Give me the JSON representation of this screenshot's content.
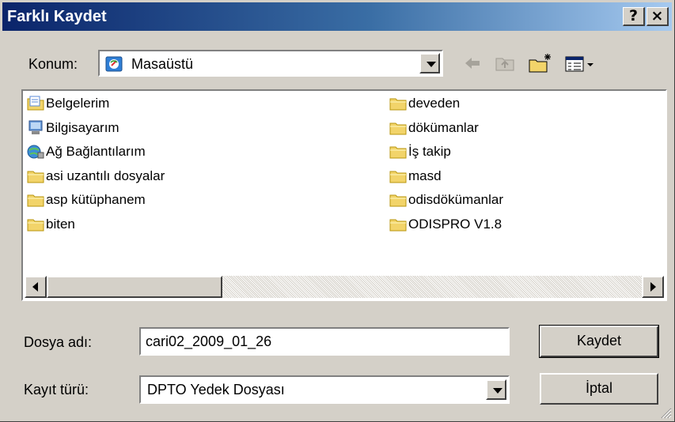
{
  "window": {
    "title": "Farklı Kaydet",
    "help_label": "?",
    "close_label": "×"
  },
  "location": {
    "label": "Konum:",
    "value": "Masaüstü"
  },
  "toolbar": {
    "icons": [
      "back-arrow-icon",
      "up-folder-icon",
      "new-folder-icon",
      "view-menu-icon"
    ]
  },
  "files": [
    {
      "name": "Belgelerim",
      "icon": "my-documents-icon"
    },
    {
      "name": "Bilgisayarım",
      "icon": "my-computer-icon"
    },
    {
      "name": "Ağ Bağlantılarım",
      "icon": "network-icon"
    },
    {
      "name": "asi uzantılı dosyalar",
      "icon": "folder-icon"
    },
    {
      "name": "asp kütüphanem",
      "icon": "folder-icon"
    },
    {
      "name": "biten",
      "icon": "folder-icon"
    },
    {
      "name": "deveden",
      "icon": "folder-icon"
    },
    {
      "name": "dökümanlar",
      "icon": "folder-icon"
    },
    {
      "name": "İş takip",
      "icon": "folder-icon"
    },
    {
      "name": "masd",
      "icon": "folder-icon"
    },
    {
      "name": "odisdökümanlar",
      "icon": "folder-icon"
    },
    {
      "name": "ODISPRO V1.8",
      "icon": "folder-icon"
    }
  ],
  "filename": {
    "label": "Dosya adı:",
    "value": "cari02_2009_01_26"
  },
  "filetype": {
    "label": "Kayıt türü:",
    "value": "DPTO Yedek Dosyası"
  },
  "buttons": {
    "save": "Kaydet",
    "cancel": "İptal"
  }
}
